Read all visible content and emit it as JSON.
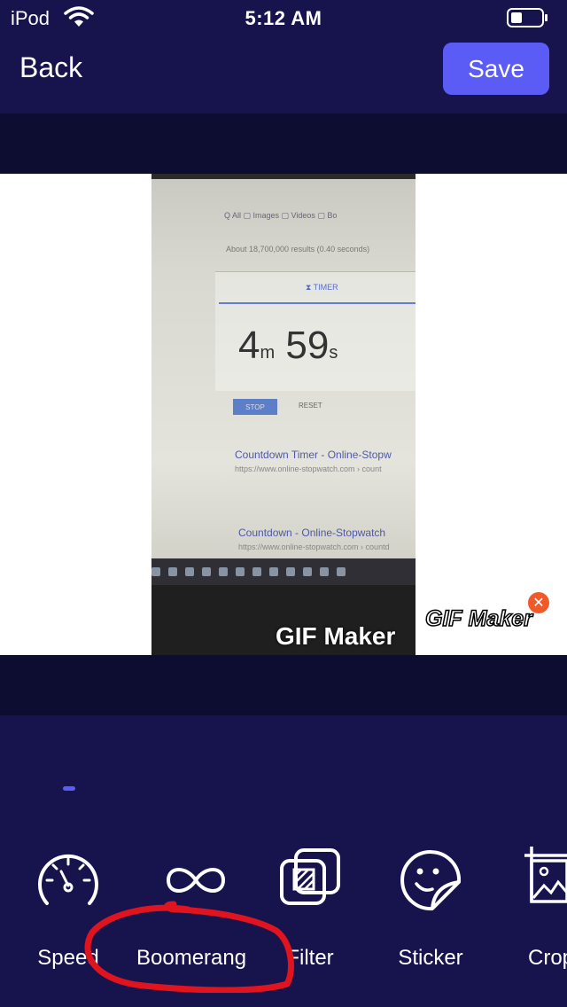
{
  "status_bar": {
    "carrier": "iPod",
    "time": "5:12 AM"
  },
  "nav": {
    "back_label": "Back",
    "save_label": "Save"
  },
  "gif_frame": {
    "tabs": "Q All    ▢ Images    ▢ Videos    ▢ Bo",
    "results_info": "About 18,700,000 results (0.40 seconds)",
    "timer_label": "⧗ TIMER",
    "timer_minutes": "4",
    "timer_minutes_unit": "m",
    "timer_seconds": "59",
    "timer_seconds_unit": "s",
    "stop_label": "STOP",
    "reset_label": "RESET",
    "result1_title": "Countdown Timer - Online-Stopw",
    "result1_url": "https://www.online-stopwatch.com › count",
    "result2_title": "Countdown - Online-Stopwatch",
    "result2_url": "https://www.online-stopwatch.com › countd",
    "watermark": "GIF Maker"
  },
  "watermark_badge": "GIF Maker",
  "tools": [
    {
      "label": "Speed",
      "icon": "speedometer-icon"
    },
    {
      "label": "Boomerang",
      "icon": "infinity-icon"
    },
    {
      "label": "Filter",
      "icon": "filter-icon"
    },
    {
      "label": "Sticker",
      "icon": "sticker-icon"
    },
    {
      "label": "Crop",
      "icon": "crop-icon"
    }
  ],
  "colors": {
    "background": "#14124a",
    "accent": "#5b5cf6",
    "annotation": "#e0141e"
  }
}
